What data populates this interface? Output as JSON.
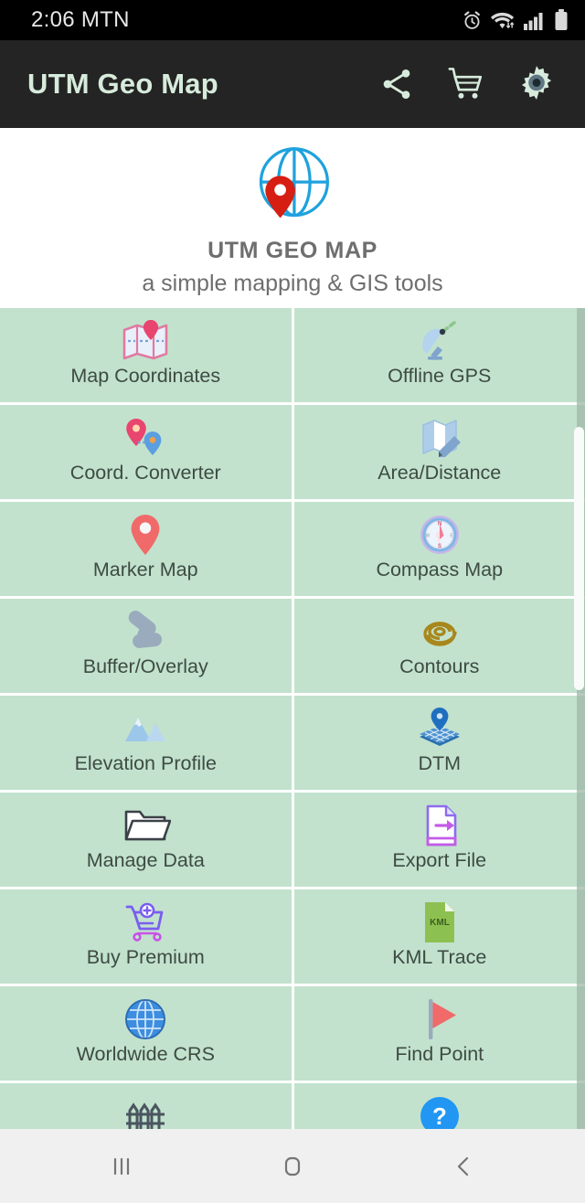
{
  "status_bar": {
    "clock": "2:06 MTN",
    "icons": [
      "alarm-icon",
      "wifi-icon",
      "cellular-signal-icon",
      "battery-icon"
    ]
  },
  "app_bar": {
    "title": "UTM Geo Map",
    "actions": [
      {
        "name": "share-icon",
        "label": "Share"
      },
      {
        "name": "cart-icon",
        "label": "Store"
      },
      {
        "name": "gear-icon",
        "label": "Settings"
      }
    ]
  },
  "brand": {
    "logo": "globe-pin-logo",
    "title": "UTM GEO MAP",
    "subtitle": "a simple mapping & GIS tools"
  },
  "menu": {
    "items": [
      {
        "label": "Map Coordinates",
        "icon": "folded-map-pin-icon"
      },
      {
        "label": "Offline GPS",
        "icon": "satellite-dish-icon"
      },
      {
        "label": "Coord. Converter",
        "icon": "two-pins-icon"
      },
      {
        "label": "Area/Distance",
        "icon": "map-pencil-icon"
      },
      {
        "label": "Marker Map",
        "icon": "map-marker-icon"
      },
      {
        "label": "Compass Map",
        "icon": "compass-icon"
      },
      {
        "label": "Buffer/Overlay",
        "icon": "buffer-overlay-icon"
      },
      {
        "label": "Contours",
        "icon": "contour-spiral-icon"
      },
      {
        "label": "Elevation Profile",
        "icon": "mountains-icon"
      },
      {
        "label": "DTM",
        "icon": "terrain-grid-pin-icon"
      },
      {
        "label": "Manage Data",
        "icon": "folder-icon"
      },
      {
        "label": "Export File",
        "icon": "file-export-icon"
      },
      {
        "label": "Buy Premium",
        "icon": "cart-plus-icon"
      },
      {
        "label": "KML Trace",
        "icon": "kml-file-icon"
      },
      {
        "label": "Worldwide CRS",
        "icon": "globe-icon"
      },
      {
        "label": "Find Point",
        "icon": "flag-icon"
      },
      {
        "label": "",
        "icon": "fence-icon"
      },
      {
        "label": "",
        "icon": "help-circle-icon"
      }
    ]
  },
  "nav_bar": {
    "buttons": [
      {
        "name": "recents-button",
        "label": "Recents"
      },
      {
        "name": "home-button",
        "label": "Home"
      },
      {
        "name": "back-button",
        "label": "Back"
      }
    ]
  },
  "colors": {
    "status_bar_bg": "#000000",
    "app_bar_bg": "#242424",
    "app_bar_text": "#d7ebdc",
    "cell_bg": "#c2e2cd",
    "cell_divider": "#ffffff",
    "label_text": "#3e4b43",
    "brand_text": "#6e6e6e",
    "nav_bar_bg": "#f0f0f0",
    "accent_red": "#e8291c",
    "accent_blue": "#1fa2dd"
  }
}
